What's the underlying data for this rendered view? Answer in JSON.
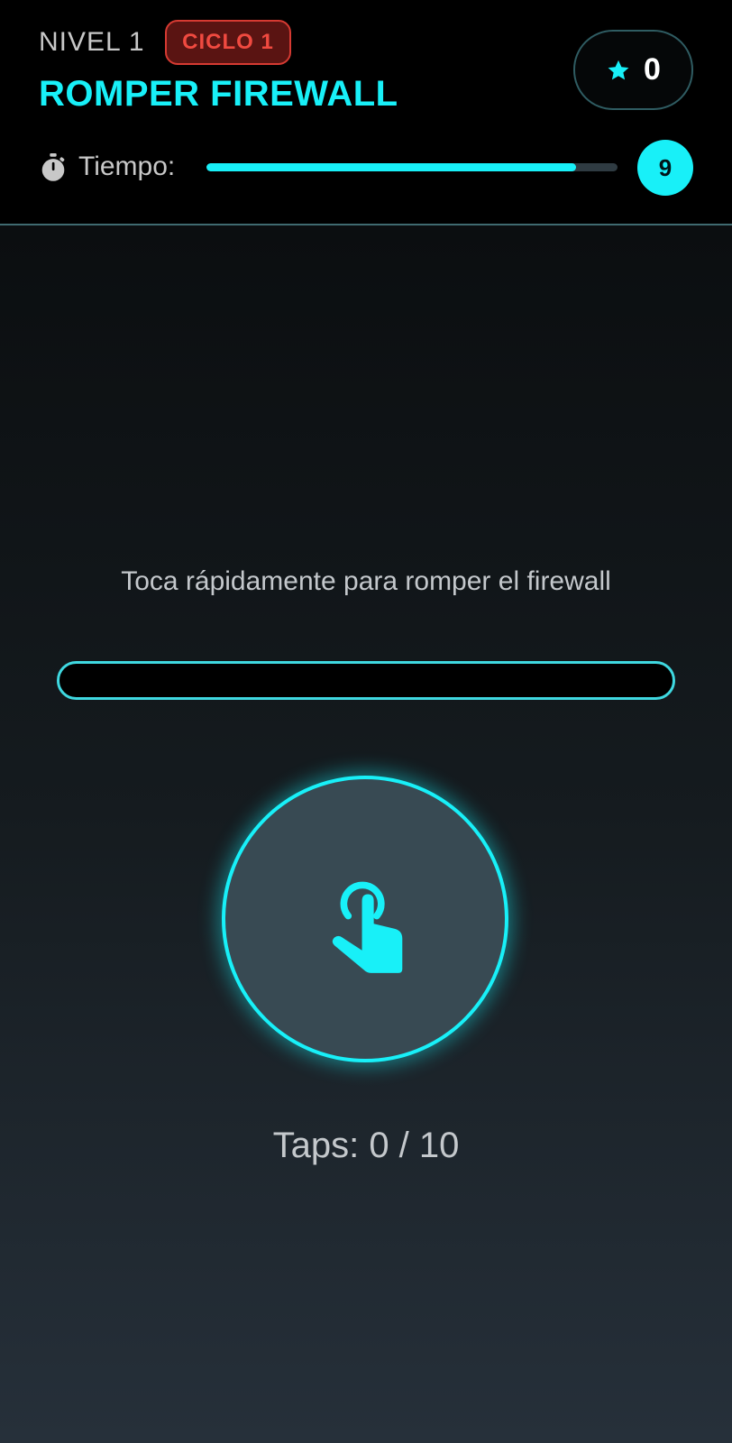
{
  "header": {
    "level_label": "NIVEL 1",
    "cycle_badge": "CICLO 1",
    "title": "ROMPER FIREWALL",
    "score": "0",
    "score_icon": "star-icon",
    "timer": {
      "label": "Tiempo:",
      "icon": "stopwatch-icon",
      "seconds_left": "9",
      "remaining_fraction": 0.9
    }
  },
  "game": {
    "instruction": "Toca rápidamente para romper el firewall",
    "progress_fraction": 0,
    "tap_icon": "touch-icon",
    "taps_counter": "Taps: 0 / 10"
  },
  "colors": {
    "accent": "#18f0f8",
    "badge_red": "#f04a40",
    "text_muted": "#c4c8cc"
  }
}
